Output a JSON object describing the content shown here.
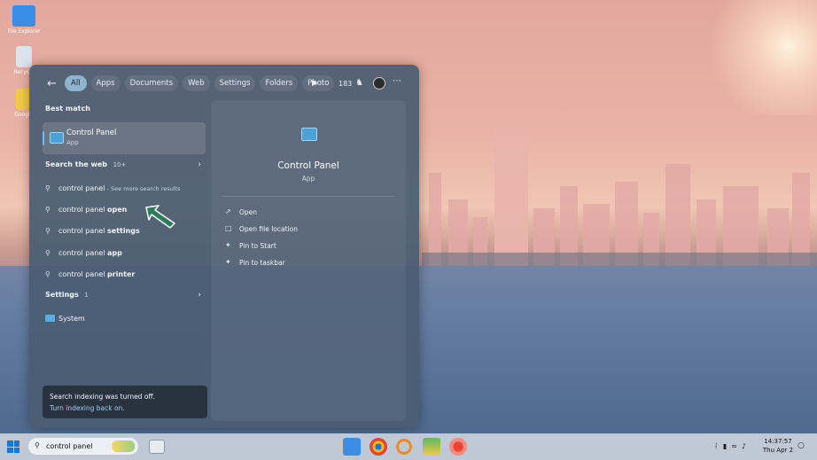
{
  "desktop": {
    "icons": [
      {
        "label": "File Explorer",
        "color": "#3a8ee6"
      },
      {
        "label": "Recycle",
        "color": "#d9e4ee"
      },
      {
        "label": "Google",
        "color": "#f2c94c"
      }
    ]
  },
  "start": {
    "back_icon": "back-arrow-icon",
    "tabs": [
      {
        "label": "All",
        "active": true
      },
      {
        "label": "Apps",
        "active": false
      },
      {
        "label": "Documents",
        "active": false
      },
      {
        "label": "Web",
        "active": false
      },
      {
        "label": "Settings",
        "active": false
      },
      {
        "label": "Folders",
        "active": false
      },
      {
        "label": "Photo",
        "active": false
      }
    ],
    "rewards_count": "183",
    "best_match": {
      "heading": "Best match",
      "title": "Control Panel",
      "subtitle": "App"
    },
    "search_web": {
      "heading": "Search the web",
      "count": "10+",
      "items": [
        {
          "prefix": "control panel",
          "bold": "",
          "suffix": " - See more search results"
        },
        {
          "prefix": "control panel ",
          "bold": "open",
          "suffix": ""
        },
        {
          "prefix": "control panel ",
          "bold": "settings",
          "suffix": ""
        },
        {
          "prefix": "control panel ",
          "bold": "app",
          "suffix": ""
        },
        {
          "prefix": "control panel ",
          "bold": "printer",
          "suffix": ""
        }
      ]
    },
    "settings": {
      "heading": "Settings",
      "count": "1",
      "item": "System"
    },
    "notice": {
      "line1": "Search indexing was turned off.",
      "line2": "Turn indexing back on."
    },
    "detail": {
      "title": "Control Panel",
      "subtitle": "App",
      "actions": [
        {
          "label": "Open",
          "icon": "open-external-icon"
        },
        {
          "label": "Open file location",
          "icon": "folder-icon"
        },
        {
          "label": "Pin to Start",
          "icon": "pin-icon"
        },
        {
          "label": "Pin to taskbar",
          "icon": "pin-icon"
        }
      ]
    }
  },
  "taskbar": {
    "search_value": "control panel",
    "clock_time": "14:37:57",
    "clock_date": "Thu Apr 2"
  }
}
